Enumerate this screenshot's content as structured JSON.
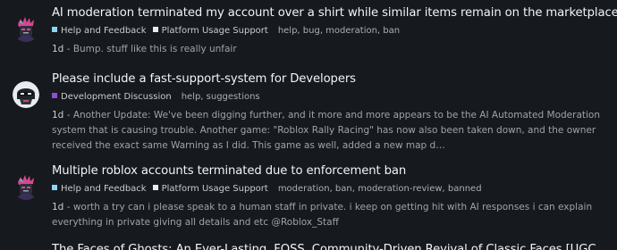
{
  "topics": [
    {
      "title": "AI moderation terminated my account over a shirt while similar items remain on the marketplace",
      "categories": [
        {
          "label": "Help and Feedback",
          "color": "#8fd3f4"
        },
        {
          "label": "Platform Usage Support",
          "color": "#e8eaed"
        }
      ],
      "tags": "help, bug, moderation, ban",
      "age": "1d",
      "excerpt": " - Bump. stuff like this is really unfair",
      "avatar_icon": "pink-punk-avatar"
    },
    {
      "title": "Please include a fast-support-system for Developers",
      "categories": [
        {
          "label": "Development Discussion",
          "color": "#8f4dd6"
        }
      ],
      "tags": "help, suggestions",
      "age": "1d",
      "excerpt": " - Another Update: We've been digging further, and it more and more appears to be the AI Automated Moderation system that is causing trouble. Another game: \"Roblox Rally Racing\" has now also been taken down, and the owner received the exact same Warning as I did. This game as well, added a new map d…",
      "avatar_icon": "helmet-avatar"
    },
    {
      "title": "Multiple roblox accounts terminated due to enforcement ban",
      "categories": [
        {
          "label": "Help and Feedback",
          "color": "#8fd3f4"
        },
        {
          "label": "Platform Usage Support",
          "color": "#e8eaed"
        }
      ],
      "tags": "moderation, ban, moderation-review, banned",
      "age": "1d",
      "excerpt": " - worth a try can i please speak to a human staff in private. i keep on getting hit with AI responses i can explain everything in private giving all details and etc @Roblox_Staff",
      "avatar_icon": "pink-punk-avatar"
    },
    {
      "title": "The Faces of Ghosts: An Ever-Lasting, FOSS, Community-Driven Revival of Classic Faces [UGC",
      "categories": [],
      "tags": "",
      "age": "",
      "excerpt": "",
      "avatar_icon": ""
    }
  ]
}
